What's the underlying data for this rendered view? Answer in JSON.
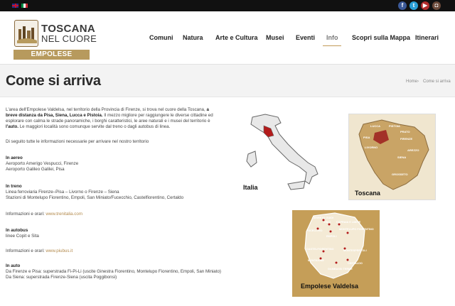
{
  "topbar": {
    "languages": [
      "en-flag-icon",
      "it-flag-icon"
    ],
    "social": [
      {
        "icon": "facebook-icon",
        "glyph": "f",
        "color": "#3b5998"
      },
      {
        "icon": "twitter-icon",
        "glyph": "t",
        "color": "#2a9fd6"
      },
      {
        "icon": "youtube-icon",
        "glyph": "▶",
        "color": "#b32c2c"
      },
      {
        "icon": "instagram-icon",
        "glyph": "◘",
        "color": "#6b4a3a"
      }
    ]
  },
  "logo": {
    "line1": "TOSCANA",
    "line2": "NEL CUORE",
    "band": "EMPOLESE VALDELSA"
  },
  "nav": {
    "items": [
      "Comuni",
      "Natura",
      "Arte e Cultura",
      "Musei",
      "Eventi",
      "Info",
      "Scopri sulla Mappa",
      "Itinerari"
    ],
    "active": "Info"
  },
  "page": {
    "title": "Come si arriva",
    "breadcrumb": {
      "home": "Home",
      "separator": "›",
      "current": "Come si arriva"
    }
  },
  "content": {
    "intro_l1_a": "L'area dell'Empolese Valdelsa, nel territorio della Provincia di Firenze, si trova nel cuore della Toscana,",
    "intro_l1_b": "a",
    "intro_l2_a": "breve distanza da Pisa, Siena, Lucca e Pistoia.",
    "intro_l2_b": "Il mezzo migliore per raggiungere le diverse cittadine ed",
    "intro_l3": "esplorare con calma le strade panoramiche, i borghi caratteristici, le aree naturali e i musei del territorio è",
    "intro_l4_a": "l'auto.",
    "intro_l4_b": "Le maggiori località sono comunque servite dal treno o dagli autobus di linea.",
    "intro_l5": "Di seguito tutte le informazioni necessarie per arrivare nel nostro territorio",
    "aereo_title": "In aereo",
    "aereo_l1": "Aeroporto Amerigo Vespucci, Firenze",
    "aereo_l2": "Aeroporto Galileo Galilei, Pisa",
    "treno_title": "In treno",
    "treno_l1": "Linea ferroviaria Firenze–Pisa – Livorno o Firenze – Siena",
    "treno_l2": "Stazioni di Montelupo Fiorentino, Empoli, San Miniato/Fucecchio, Castelfiorentino, Certaldo",
    "treno_info": "Informazioni e orari:",
    "treno_link": "www.trenitalia.com",
    "autobus_title": "In autobus",
    "autobus_l1": "linee Copit e Sita",
    "autobus_info": "Informazioni e orari:",
    "autobus_link": "www.piubus.it",
    "auto_title": "In auto",
    "auto_l1": "Da Firenze e Pisa: superstrada Fi-Pi-Li (uscite Ginestra Fiorentino, Montelupo Fiorentino, Empoli, San Miniato)",
    "auto_l2": "Da Siena: superstrada Firenze-Siena (uscita Poggibonsi)"
  },
  "maps": {
    "italia_label": "Italia",
    "toscana_label": "Toscana",
    "empolese_label": "Empolese Valdelsa",
    "toscana_towns": [
      "LUCCA",
      "PISTOIA",
      "PRATO",
      "FIRENZE",
      "AREZZO",
      "SIENA",
      "PISA",
      "LIVORNO",
      "GROSSETO"
    ],
    "empolese_towns": [
      "CERRETO GUIDI",
      "VINCI",
      "CAPRAIA E LIMITE",
      "FUCECCHIO",
      "EMPOLI",
      "MONTELUPO FIORENTINO",
      "MONTESPERTOLI",
      "CASTELFIORENTINO",
      "MONTAIONE",
      "GAMBASSI TERME",
      "CERTALDO"
    ]
  },
  "colors": {
    "accent": "#b79a5d",
    "link": "#b38a4c",
    "topbar": "#111111",
    "map_gold": "#c59e58"
  }
}
